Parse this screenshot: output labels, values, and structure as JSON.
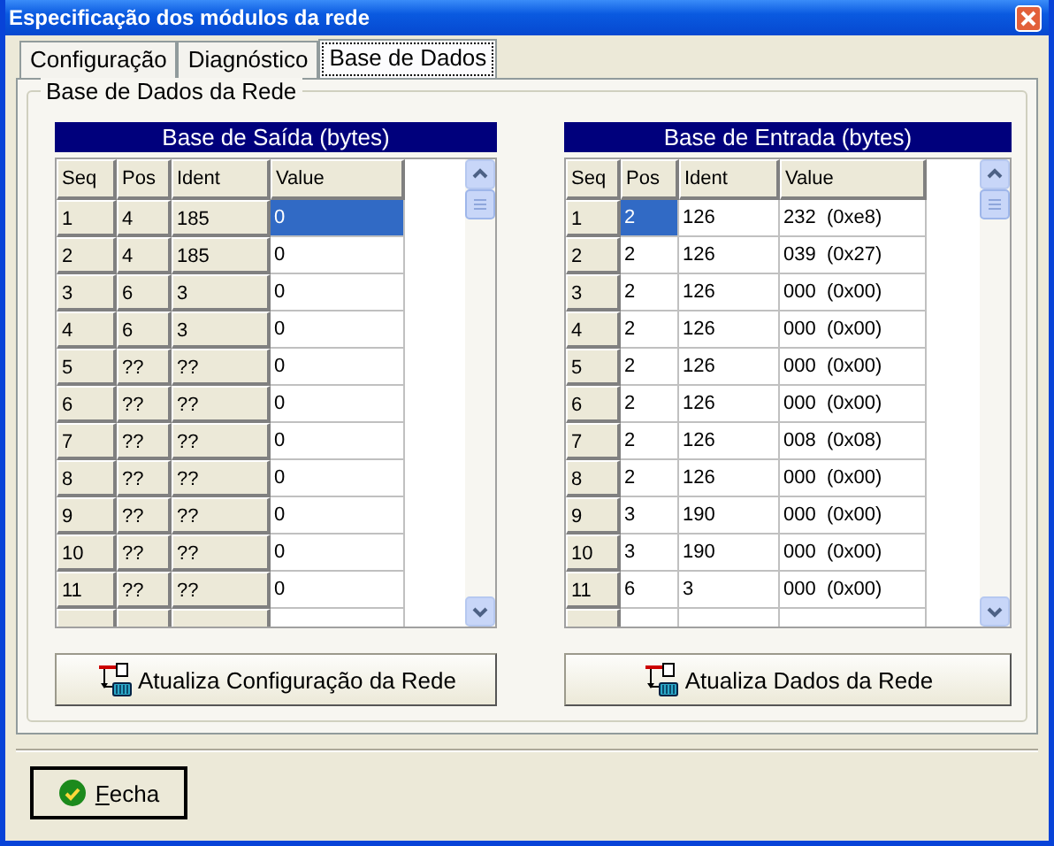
{
  "window": {
    "title": "Especificação dos módulos da rede"
  },
  "tabs": [
    {
      "label": "Configuração",
      "selected": false
    },
    {
      "label": "Diagnóstico",
      "selected": false
    },
    {
      "label": "Base de Dados",
      "selected": true
    }
  ],
  "group": {
    "title": "Base de Dados da Rede"
  },
  "tables": [
    {
      "title": "Base de Saída (bytes)",
      "columns": [
        {
          "label": "Seq",
          "fixed": true
        },
        {
          "label": "Pos",
          "fixed": true
        },
        {
          "label": "Ident",
          "fixed": true
        },
        {
          "label": "Value",
          "fixed": false
        }
      ],
      "rows": [
        {
          "cells": [
            "1",
            "4",
            "185",
            "0"
          ],
          "selected": true
        },
        {
          "cells": [
            "2",
            "4",
            "185",
            "0"
          ],
          "selected": false
        },
        {
          "cells": [
            "3",
            "6",
            "3",
            "0"
          ],
          "selected": false
        },
        {
          "cells": [
            "4",
            "6",
            "3",
            "0"
          ],
          "selected": false
        },
        {
          "cells": [
            "5",
            "??",
            "??",
            "0"
          ],
          "selected": false
        },
        {
          "cells": [
            "6",
            "??",
            "??",
            "0"
          ],
          "selected": false
        },
        {
          "cells": [
            "7",
            "??",
            "??",
            "0"
          ],
          "selected": false
        },
        {
          "cells": [
            "8",
            "??",
            "??",
            "0"
          ],
          "selected": false
        },
        {
          "cells": [
            "9",
            "??",
            "??",
            "0"
          ],
          "selected": false
        },
        {
          "cells": [
            "10",
            "??",
            "??",
            "0"
          ],
          "selected": false
        },
        {
          "cells": [
            "11",
            "??",
            "??",
            "0"
          ],
          "selected": false
        }
      ],
      "button": "Atualiza Configuração da Rede"
    },
    {
      "title": "Base de Entrada (bytes)",
      "columns": [
        {
          "label": "Seq",
          "fixed": true
        },
        {
          "label": "Pos",
          "fixed": false
        },
        {
          "label": "Ident",
          "fixed": false
        },
        {
          "label": "Value",
          "fixed": false
        }
      ],
      "rows": [
        {
          "cells": [
            "1",
            "2",
            "126",
            "232  (0xe8)"
          ],
          "selected": true
        },
        {
          "cells": [
            "2",
            "2",
            "126",
            "039  (0x27)"
          ],
          "selected": false
        },
        {
          "cells": [
            "3",
            "2",
            "126",
            "000  (0x00)"
          ],
          "selected": false
        },
        {
          "cells": [
            "4",
            "2",
            "126",
            "000  (0x00)"
          ],
          "selected": false
        },
        {
          "cells": [
            "5",
            "2",
            "126",
            "000  (0x00)"
          ],
          "selected": false
        },
        {
          "cells": [
            "6",
            "2",
            "126",
            "000  (0x00)"
          ],
          "selected": false
        },
        {
          "cells": [
            "7",
            "2",
            "126",
            "008  (0x08)"
          ],
          "selected": false
        },
        {
          "cells": [
            "8",
            "2",
            "126",
            "000  (0x00)"
          ],
          "selected": false
        },
        {
          "cells": [
            "9",
            "3",
            "190",
            "000  (0x00)"
          ],
          "selected": false
        },
        {
          "cells": [
            "10",
            "3",
            "190",
            "000  (0x00)"
          ],
          "selected": false
        },
        {
          "cells": [
            "11",
            "6",
            "3",
            "000  (0x00)"
          ],
          "selected": false
        }
      ],
      "button": "Atualiza Dados da Rede"
    }
  ],
  "close_button": "Fecha"
}
